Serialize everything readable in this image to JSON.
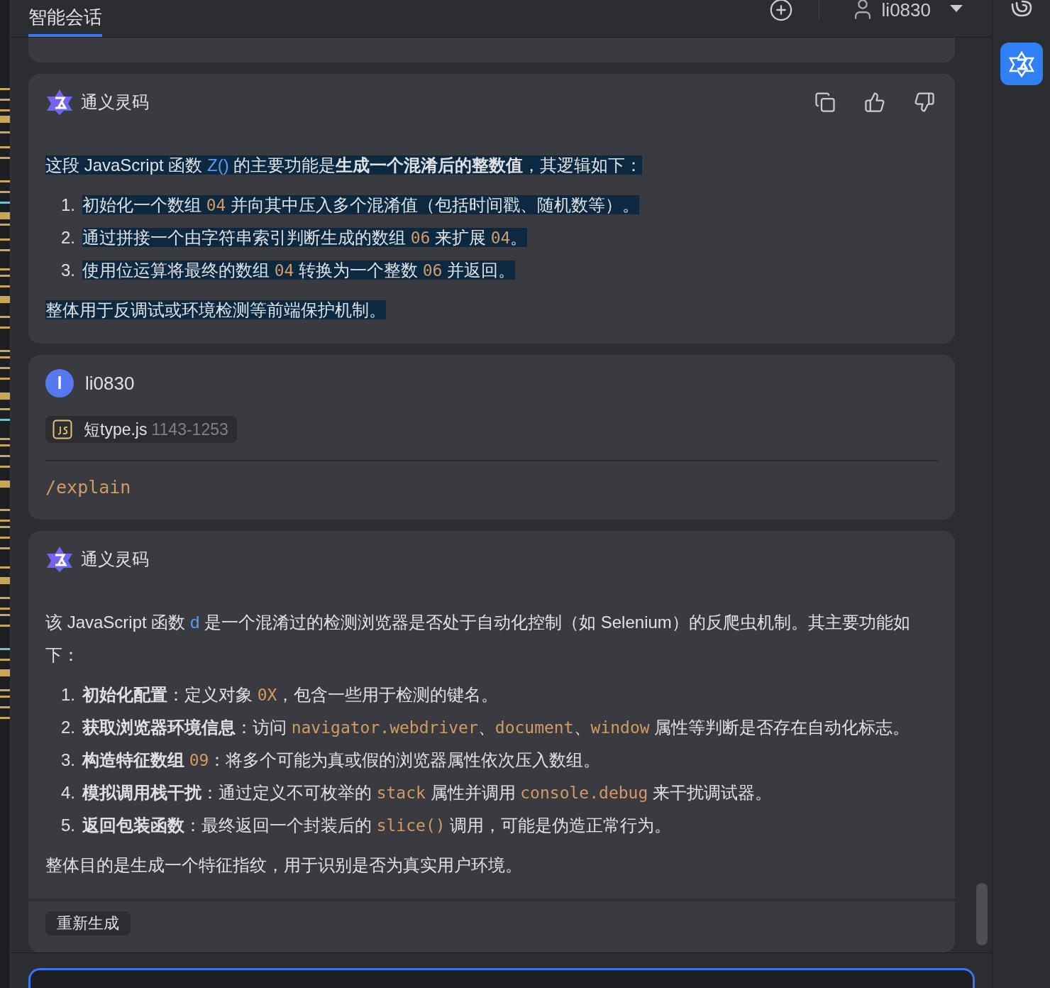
{
  "header": {
    "tabs": [
      {
        "label": "智能会话",
        "selected": true
      }
    ],
    "user": "li0830"
  },
  "messages": [
    {
      "kind": "bot",
      "author": "通义灵码",
      "actions": true,
      "blocks": [
        {
          "kind": "paragraph",
          "highlighted": true,
          "segments": [
            {
              "kind": "text",
              "text": "这段 JavaScript 函数 "
            },
            {
              "kind": "name",
              "text": "Z()"
            },
            {
              "kind": "text",
              "text": " 的主要功能是"
            },
            {
              "kind": "bold",
              "text": "生成一个混淆后的整数值"
            },
            {
              "kind": "text",
              "text": "，其逻辑如下："
            }
          ]
        },
        {
          "kind": "list",
          "highlighted": true,
          "items": [
            {
              "number": "1.",
              "segments": [
                {
                  "kind": "text",
                  "text": "初始化一个数组 "
                },
                {
                  "kind": "code",
                  "text": "04"
                },
                {
                  "kind": "text",
                  "text": " 并向其中压入多个混淆值（包括时间戳、随机数等）。"
                }
              ]
            },
            {
              "number": "2.",
              "segments": [
                {
                  "kind": "text",
                  "text": "通过拼接一个由字符串索引判断生成的数组 "
                },
                {
                  "kind": "code",
                  "text": "06"
                },
                {
                  "kind": "text",
                  "text": " 来扩展 "
                },
                {
                  "kind": "code",
                  "text": "04"
                },
                {
                  "kind": "text",
                  "text": "。"
                }
              ]
            },
            {
              "number": "3.",
              "segments": [
                {
                  "kind": "text",
                  "text": "使用位运算将最终的数组 "
                },
                {
                  "kind": "code",
                  "text": "04"
                },
                {
                  "kind": "text",
                  "text": " 转换为一个整数 "
                },
                {
                  "kind": "code",
                  "text": "06"
                },
                {
                  "kind": "text",
                  "text": " 并返回。"
                }
              ]
            }
          ]
        },
        {
          "kind": "paragraph",
          "highlighted": true,
          "segments": [
            {
              "kind": "text",
              "text": "整体用于反调试或环境检测等前端保护机制。"
            }
          ]
        }
      ]
    },
    {
      "kind": "user",
      "author": "li0830",
      "avatar": "l",
      "file": {
        "name": "短type.js",
        "lines": "1143-1253"
      },
      "command": "/explain"
    },
    {
      "kind": "bot",
      "author": "通义灵码",
      "actions": false,
      "regenerate": "重新生成",
      "blocks": [
        {
          "kind": "paragraph",
          "highlighted": false,
          "segments": [
            {
              "kind": "text",
              "text": "该 JavaScript 函数 "
            },
            {
              "kind": "name",
              "text": "d"
            },
            {
              "kind": "text",
              "text": " 是一个混淆过的检测浏览器是否处于自动化控制（如 Selenium）的反爬虫机制。其主要功能如下："
            }
          ]
        },
        {
          "kind": "list",
          "highlighted": false,
          "items": [
            {
              "number": "1.",
              "segments": [
                {
                  "kind": "bold",
                  "text": "初始化配置"
                },
                {
                  "kind": "text",
                  "text": "：定义对象 "
                },
                {
                  "kind": "code",
                  "text": "0X"
                },
                {
                  "kind": "text",
                  "text": "，包含一些用于检测的键名。"
                }
              ]
            },
            {
              "number": "2.",
              "segments": [
                {
                  "kind": "bold",
                  "text": "获取浏览器环境信息"
                },
                {
                  "kind": "text",
                  "text": "：访问 "
                },
                {
                  "kind": "code",
                  "text": "navigator.webdriver"
                },
                {
                  "kind": "text",
                  "text": "、"
                },
                {
                  "kind": "code",
                  "text": "document"
                },
                {
                  "kind": "text",
                  "text": "、"
                },
                {
                  "kind": "code",
                  "text": "window"
                },
                {
                  "kind": "text",
                  "text": " 属性等判断是否存在自动化标志。"
                }
              ]
            },
            {
              "number": "3.",
              "segments": [
                {
                  "kind": "bold",
                  "text": "构造特征数组 "
                },
                {
                  "kind": "code",
                  "text": "09"
                },
                {
                  "kind": "text",
                  "text": "：将多个可能为真或假的浏览器属性依次压入数组。"
                }
              ]
            },
            {
              "number": "4.",
              "segments": [
                {
                  "kind": "bold",
                  "text": "模拟调用栈干扰"
                },
                {
                  "kind": "text",
                  "text": "：通过定义不可枚举的 "
                },
                {
                  "kind": "code",
                  "text": "stack"
                },
                {
                  "kind": "text",
                  "text": " 属性并调用 "
                },
                {
                  "kind": "code",
                  "text": "console.debug"
                },
                {
                  "kind": "text",
                  "text": " 来干扰调试器。"
                }
              ]
            },
            {
              "number": "5.",
              "segments": [
                {
                  "kind": "bold",
                  "text": "返回包装函数"
                },
                {
                  "kind": "text",
                  "text": "：最终返回一个封装后的 "
                },
                {
                  "kind": "code",
                  "text": "slice()"
                },
                {
                  "kind": "text",
                  "text": " 调用，可能是伪造正常行为。"
                }
              ]
            }
          ]
        },
        {
          "kind": "paragraph",
          "highlighted": false,
          "segments": [
            {
              "kind": "text",
              "text": "整体目的是生成一个特征指纹，用于识别是否为真实用户环境。"
            }
          ]
        }
      ]
    }
  ]
}
